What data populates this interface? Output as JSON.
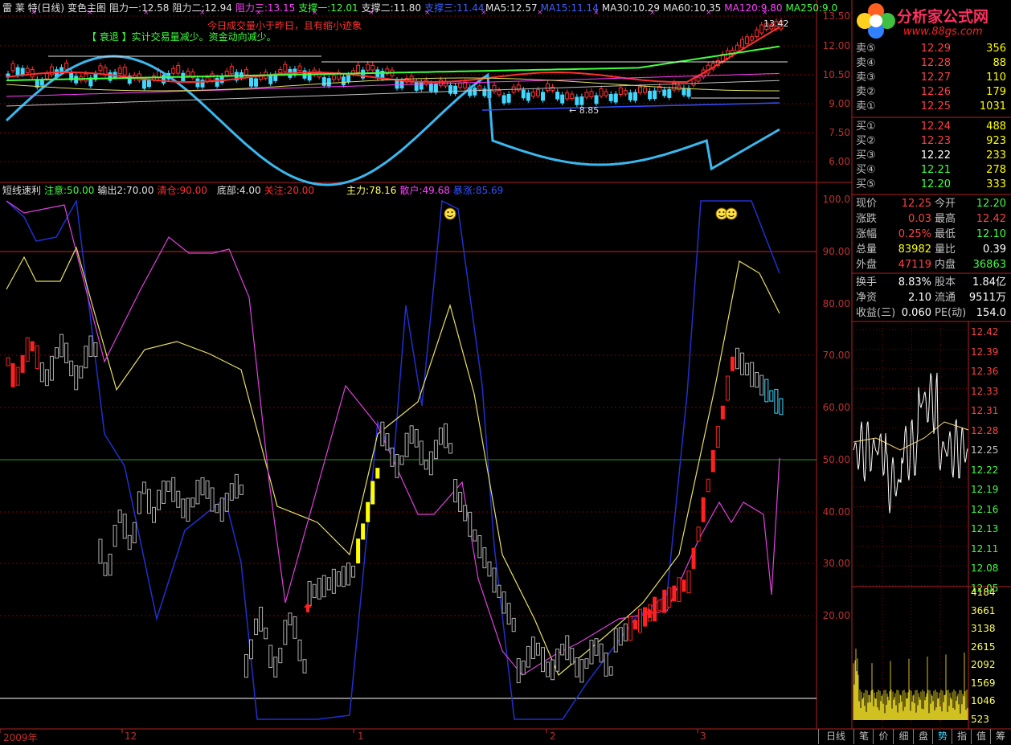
{
  "header1": {
    "stock": "雷 莱 特",
    "period": "(日线)",
    "indicator": "变色主图",
    "r1": "阻力一:12.58",
    "r2": "阻力二:12.94",
    "r3": "阻力三:13.15",
    "s1": "支撑一:12.01",
    "s2": "支撑二:11.80",
    "s3": "支撑三:11.44",
    "ma5": "MA5:12.57",
    "ma15": "MA15:11.14",
    "ma30": "MA30:10.29",
    "ma60": "MA60:10.35",
    "ma120": "MA120:9.80",
    "ma250": "MA250:9.0"
  },
  "notes": {
    "line1": "今日成交量小于昨日，且有缩小迹象",
    "line2": "【 衰退 】实计交易量减少。资金动向减少。"
  },
  "annotations": {
    "high_label": "13.42",
    "low_label": "8.85"
  },
  "header2": {
    "name": "短线速利",
    "attention": "注意:50.00",
    "output": "输出2:70.00",
    "clear": "清仓:90.00",
    "bottom": "底部:4.00",
    "focus": "关注:20.00",
    "main_force": "主力:78.16",
    "retail": "散户:49.68",
    "fury": "暴涨:85.69"
  },
  "price_axis": [
    "13.50",
    "12.00",
    "10.50",
    "9.00",
    "7.50",
    "6.00"
  ],
  "osc_axis": [
    "100.0",
    "90.00",
    "80.00",
    "70.00",
    "60.00",
    "50.00",
    "40.00",
    "30.00",
    "20.00"
  ],
  "logo": {
    "title": "分析家公式网",
    "url": "www.88gs.com"
  },
  "order_book": {
    "sell": [
      {
        "label": "卖⑤",
        "price": "12.29",
        "vol": "356"
      },
      {
        "label": "卖④",
        "price": "12.28",
        "vol": "88"
      },
      {
        "label": "卖③",
        "price": "12.27",
        "vol": "110"
      },
      {
        "label": "卖②",
        "price": "12.26",
        "vol": "179"
      },
      {
        "label": "卖①",
        "price": "12.25",
        "vol": "1031"
      }
    ],
    "buy": [
      {
        "label": "买①",
        "price": "12.24",
        "vol": "488"
      },
      {
        "label": "买②",
        "price": "12.23",
        "vol": "923"
      },
      {
        "label": "买③",
        "price": "12.22",
        "vol": "233"
      },
      {
        "label": "买④",
        "price": "12.21",
        "vol": "278"
      },
      {
        "label": "买⑤",
        "price": "12.20",
        "vol": "333"
      }
    ]
  },
  "stats": [
    {
      "k1": "现价",
      "v1": "12.25",
      "c1": "#ff4040",
      "k2": "今开",
      "v2": "12.20",
      "c2": "#40ff40"
    },
    {
      "k1": "涨跌",
      "v1": "0.03",
      "c1": "#ff4040",
      "k2": "最高",
      "v2": "12.42",
      "c2": "#ff4040"
    },
    {
      "k1": "涨幅",
      "v1": "0.25%",
      "c1": "#ff4040",
      "k2": "最低",
      "v2": "12.10",
      "c2": "#40ff40"
    },
    {
      "k1": "总量",
      "v1": "83982",
      "c1": "#ffff00",
      "k2": "量比",
      "v2": "0.39",
      "c2": "#ffffff"
    },
    {
      "k1": "外盘",
      "v1": "47119",
      "c1": "#ff4040",
      "k2": "内盘",
      "v2": "36863",
      "c2": "#40ff40"
    }
  ],
  "stats2": [
    {
      "k1": "换手",
      "v1": "8.83%",
      "k2": "股本",
      "v2": "1.84亿"
    },
    {
      "k1": "净资",
      "v1": "2.10",
      "k2": "流通",
      "v2": "9511万"
    },
    {
      "k1": "收益(三)",
      "v1": "0.060",
      "k2": "PE(动)",
      "v2": "154.0"
    }
  ],
  "mini_price_axis": [
    "12.42",
    "12.39",
    "12.36",
    "12.33",
    "12.31",
    "12.28",
    "12.25",
    "12.22",
    "12.19",
    "12.16",
    "12.13",
    "12.11",
    "12.08",
    "12.05"
  ],
  "mini_vol_axis": [
    "4184",
    "3661",
    "3138",
    "2615",
    "2092",
    "1569",
    "1046",
    "523"
  ],
  "dates": [
    "2009年",
    "12",
    "1",
    "2",
    "3"
  ],
  "bottom_tabs": [
    "日线",
    "笔",
    "价",
    "细",
    "盘",
    "势",
    "指",
    "值",
    "筹"
  ],
  "colors": {
    "up": "#ff3030",
    "down": "#40d8ff",
    "grid": "#800000",
    "axis": "#c03030"
  }
}
